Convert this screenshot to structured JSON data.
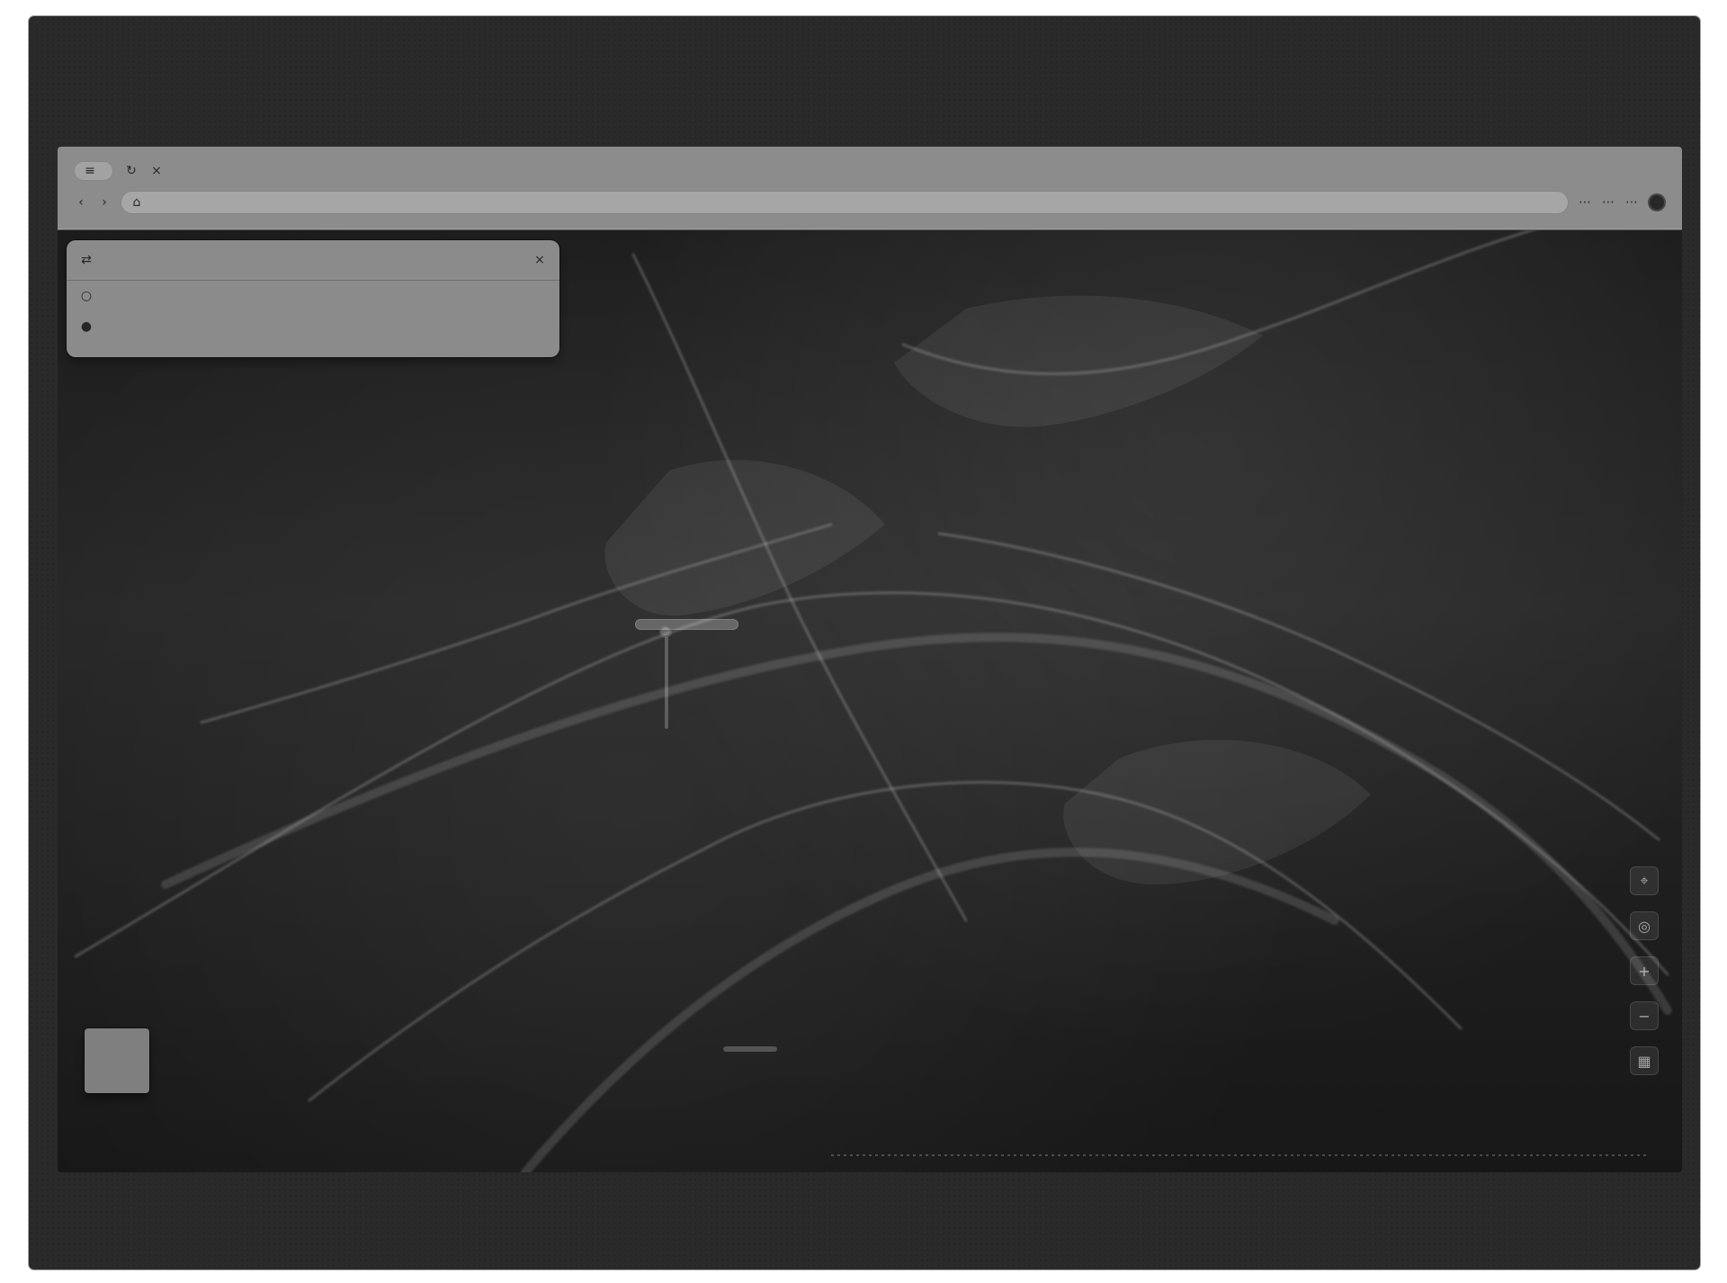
{
  "browser": {
    "tab_label": "",
    "url_text": ""
  },
  "panel": {
    "header_text": "",
    "line_1": "",
    "line_2": ""
  },
  "icons": {
    "menu": "menu-icon",
    "reload": "reload-icon",
    "back": "back-icon",
    "forward": "forward-icon",
    "site": "site-icon",
    "extensions": "extensions-icon",
    "profile": "profile-icon",
    "close": "close-icon",
    "directions": "directions-icon",
    "layers": "layers-icon",
    "zoom_in": "zoom-in-icon",
    "zoom_out": "zoom-out-icon",
    "locate": "locate-icon",
    "compass": "compass-icon"
  },
  "colors": {
    "print_background": "#2a2a2a",
    "chrome_gray": "#8b8b8b",
    "panel_gray": "#8a8a8a"
  },
  "map": {
    "bottom_left_text": ""
  }
}
